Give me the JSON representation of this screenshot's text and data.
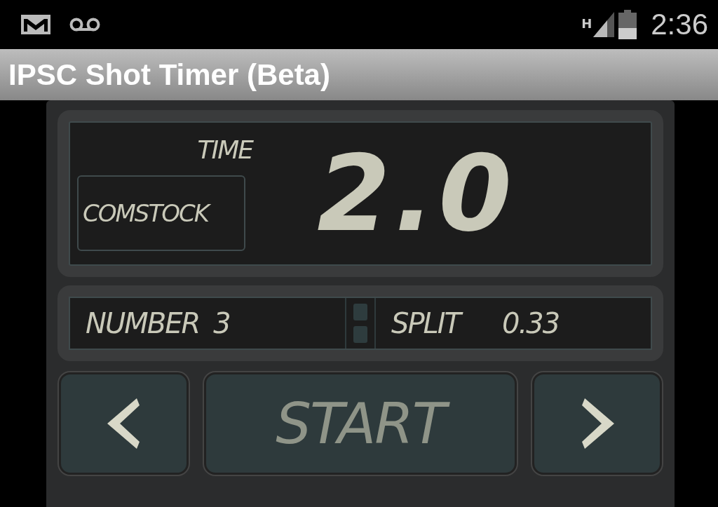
{
  "status_bar": {
    "network": "H",
    "time": "2:36"
  },
  "title": "IPSC Shot Timer (Beta)",
  "display": {
    "time_label": "TIME",
    "mode": "COMSTOCK",
    "time": "2.0"
  },
  "info": {
    "number_label": "NUMBER",
    "number": "3",
    "split_label": "SPLIT",
    "split": "0.33",
    "lights": [
      {
        "on": false
      },
      {
        "on": false
      }
    ]
  },
  "buttons": [
    {
      "kind": "prev"
    },
    {
      "kind": "start",
      "label": "START"
    },
    {
      "kind": "next"
    }
  ]
}
